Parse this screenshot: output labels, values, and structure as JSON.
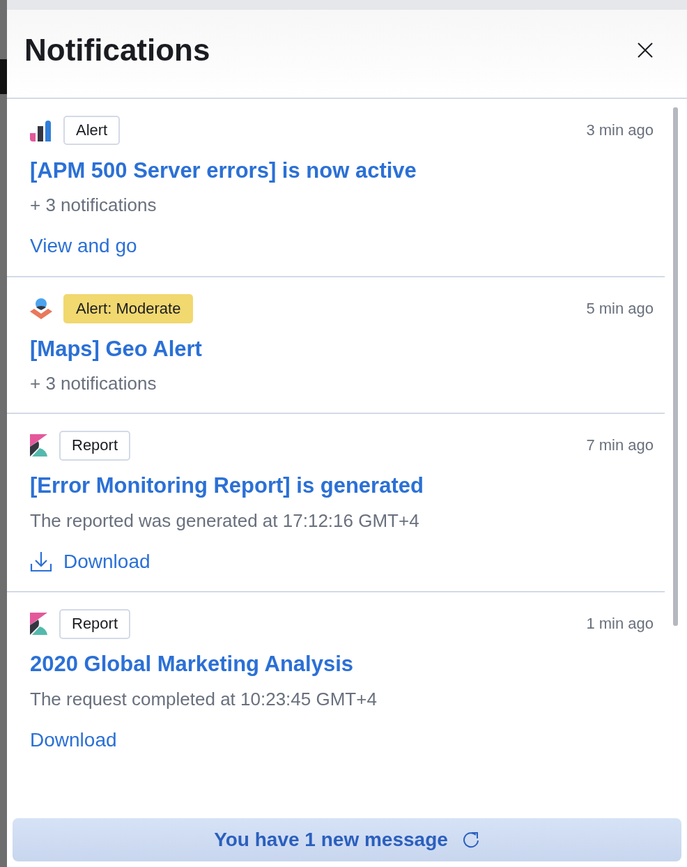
{
  "header": {
    "title": "Notifications"
  },
  "notifications": [
    {
      "kind": "apm",
      "badge": {
        "label": "Alert",
        "color": "#ffffff"
      },
      "time": "3 min ago",
      "title": "[APM 500 Server errors] is now active",
      "description": "+ 3 notifications",
      "action": {
        "label": "View and go",
        "kind": "link"
      }
    },
    {
      "kind": "maps",
      "badge": {
        "label": "Alert: Moderate",
        "color": "#f1d86f"
      },
      "time": "5 min ago",
      "title": "[Maps] Geo Alert",
      "description": "+ 3 notifications"
    },
    {
      "kind": "report",
      "badge": {
        "label": "Report",
        "color": "#ffffff"
      },
      "time": "7 min ago",
      "title": "[Error Monitoring Report] is generated",
      "description": "The reported was generated at 17:12:16 GMT+4",
      "action": {
        "label": "Download",
        "kind": "download"
      }
    },
    {
      "kind": "report",
      "badge": {
        "label": "Report",
        "color": "#ffffff"
      },
      "time": "1 min ago",
      "title": "2020 Global Marketing Analysis",
      "description": "The request completed at 10:23:45 GMT+4",
      "action": {
        "label": "Download",
        "kind": "link"
      }
    }
  ],
  "banner": {
    "text": "You have 1 new message"
  }
}
